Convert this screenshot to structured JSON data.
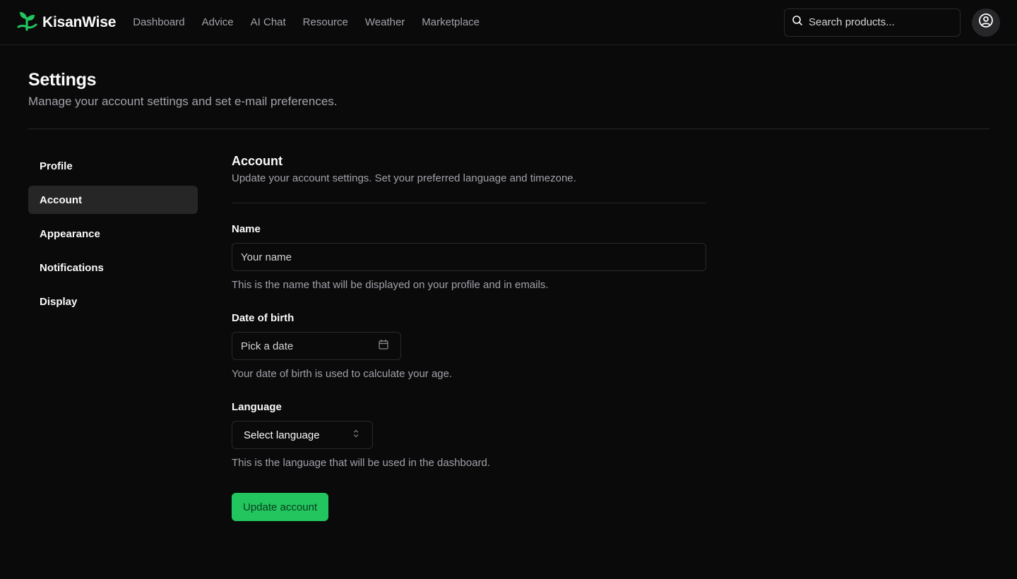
{
  "app": {
    "name": "KisanWise",
    "accent_color": "#22c55e"
  },
  "nav": {
    "items": [
      {
        "label": "Dashboard"
      },
      {
        "label": "Advice"
      },
      {
        "label": "AI Chat"
      },
      {
        "label": "Resource"
      },
      {
        "label": "Weather"
      },
      {
        "label": "Marketplace"
      }
    ]
  },
  "search": {
    "placeholder": "Search products...",
    "value": ""
  },
  "page": {
    "title": "Settings",
    "subtitle": "Manage your account settings and set e-mail preferences."
  },
  "sidebar": {
    "active": "Account",
    "items": [
      {
        "label": "Profile"
      },
      {
        "label": "Account"
      },
      {
        "label": "Appearance"
      },
      {
        "label": "Notifications"
      },
      {
        "label": "Display"
      }
    ]
  },
  "form": {
    "title": "Account",
    "description": "Update your account settings. Set your preferred language and timezone.",
    "name": {
      "label": "Name",
      "placeholder": "Your name",
      "value": "",
      "help": "This is the name that will be displayed on your profile and in emails."
    },
    "dob": {
      "label": "Date of birth",
      "placeholder": "Pick a date",
      "help": "Your date of birth is used to calculate your age."
    },
    "language": {
      "label": "Language",
      "placeholder": "Select language",
      "help": "This is the language that will be used in the dashboard."
    },
    "submit_label": "Update account"
  }
}
